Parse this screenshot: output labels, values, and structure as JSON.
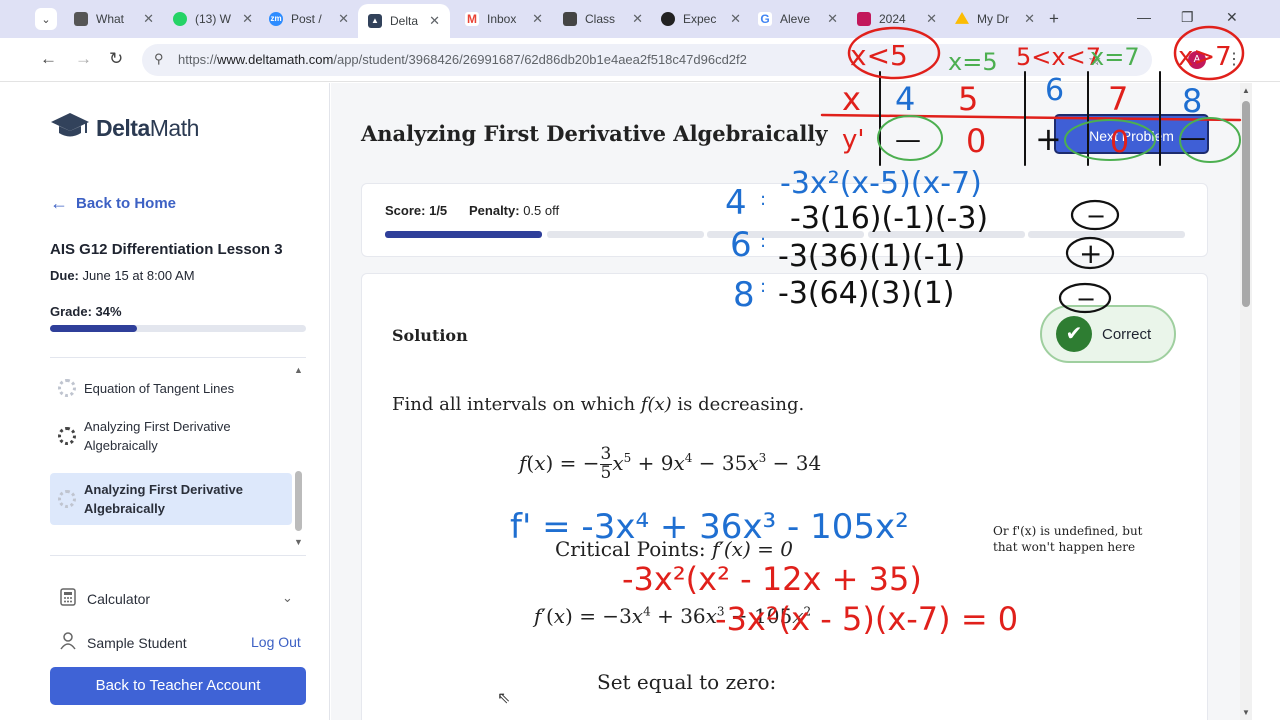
{
  "browser": {
    "tabs": [
      {
        "label": "What",
        "fav_color": "#555555"
      },
      {
        "label": "(13) W",
        "fav_color": "#25d366"
      },
      {
        "label": "Post /",
        "fav_color": "#2d8cff"
      },
      {
        "label": "Delta",
        "fav_color": "#32425b",
        "active": true
      },
      {
        "label": "Inbox",
        "fav_color": "#ea4335"
      },
      {
        "label": "Class",
        "fav_color": "#444444"
      },
      {
        "label": "Expec",
        "fav_color": "#222222"
      },
      {
        "label": "Aleve",
        "fav_color": "#4285f4"
      },
      {
        "label": "2024",
        "fav_color": "#c2185b"
      },
      {
        "label": "My Dr",
        "fav_color": "#fbbc04"
      }
    ],
    "url_prefix": "https://",
    "url_domain": "www.deltamath.com",
    "url_path": "/app/student/3968426/26991687/62d86db20b1e4aea2f518c47d96cd2f2",
    "profile_initial": "A"
  },
  "sidebar": {
    "logo_bold": "Delta",
    "logo_rest": "Math",
    "back_label": "Back to Home",
    "assignment_title": "AIS G12 Differentiation Lesson 3",
    "due_label": "Due:",
    "due_value": "June 15 at 8:00 AM",
    "grade_label": "Grade:",
    "grade_value": "34%",
    "grade_fraction": 0.34,
    "problems": [
      {
        "label": "Equation of Tangent Lines"
      },
      {
        "label": "Analyzing First Derivative Algebraically"
      },
      {
        "label": "Analyzing First Derivative Algebraically",
        "active": true
      }
    ],
    "calculator_label": "Calculator",
    "user_name": "Sample Student",
    "logout_label": "Log Out",
    "teacher_button": "Back to Teacher Account"
  },
  "main": {
    "title": "Analyzing First Derivative Algebraically",
    "next_button": "Next Problem",
    "score_label": "Score:",
    "score_value": "1/5",
    "penalty_label": "Penalty:",
    "penalty_value": "0.5 off",
    "solution_heading": "Solution",
    "correct_label": "Correct",
    "question_prefix": "Find all intervals on which",
    "question_fn": "f(x)",
    "question_suffix": "is decreasing.",
    "critical_points_label": "Critical Points:",
    "critical_points_eq": "f′(x) = 0",
    "note": "Or f'(x) is undefined, but that won't happen here",
    "set_equal": "Set equal to zero:"
  },
  "annotations": {
    "sign_chart_header": [
      "x<5",
      "x=5",
      "5<x<7",
      "x=7",
      "x>7"
    ],
    "sign_chart_x": [
      "x",
      "4",
      "5",
      "6",
      "7",
      "8"
    ],
    "sign_chart_y": [
      "y'",
      "—",
      "0",
      "+",
      "0",
      "—"
    ],
    "factored": "-3x²(x-5)(x-7)",
    "test_values": [
      {
        "x": "4",
        "calc": "-3(16)(-1)(-3)",
        "sign": "−"
      },
      {
        "x": "6",
        "calc": "-3(36)(1)(-1)",
        "sign": "+"
      },
      {
        "x": "8",
        "calc": "-3(64)(3)(1)",
        "sign": "−"
      }
    ],
    "derivative_handwritten": "f' = -3x⁴ + 36x³ - 105x²",
    "factor_step1": "-3x²(x² - 12x + 35)",
    "factor_step2": "-3x²(x - 5)(x-7) = 0",
    "colors": {
      "blue": "#1f6fd1",
      "red": "#e0201b",
      "green": "#4caf50",
      "black": "#111111"
    }
  }
}
